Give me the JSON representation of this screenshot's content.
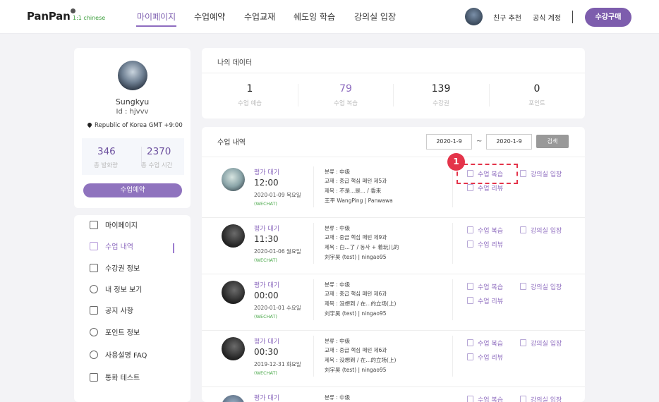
{
  "header": {
    "logo_text": "PanPan",
    "logo_sub": "1:1 chinese",
    "nav": [
      "마이페이지",
      "수업예약",
      "수업교재",
      "쉐도잉 학습",
      "강의실 입장"
    ],
    "links": [
      "친구 추천",
      "공식 계정"
    ],
    "buy_label": "수강구매"
  },
  "profile": {
    "name": "Sungkyu",
    "id_line": "Id : hjvvv",
    "location": "Republic of Korea GMT +9:00",
    "stats": [
      {
        "value": "346",
        "label": "총 발화량"
      },
      {
        "value": "2370",
        "label": "총 수업 시간"
      }
    ],
    "book_label": "수업예약"
  },
  "menu": [
    {
      "label": "마이페이지",
      "icon": "home-icon"
    },
    {
      "label": "수업 내역",
      "icon": "calendar-icon",
      "active": true
    },
    {
      "label": "수강권 정보",
      "icon": "ticket-icon"
    },
    {
      "label": "내 정보 보기",
      "icon": "user-icon"
    },
    {
      "label": "공지 사항",
      "icon": "notice-icon"
    },
    {
      "label": "포인트 정보",
      "icon": "percent-icon"
    },
    {
      "label": "사용설명 FAQ",
      "icon": "help-icon"
    },
    {
      "label": "통화 테스트",
      "icon": "document-icon"
    }
  ],
  "summary": {
    "title": "나의 데이터",
    "items": [
      {
        "value": "1",
        "label": "수업 예습"
      },
      {
        "value": "79",
        "label": "수업 복습"
      },
      {
        "value": "139",
        "label": "수강권"
      },
      {
        "value": "0",
        "label": "포인트"
      }
    ]
  },
  "history": {
    "title": "수업 내역",
    "date_from": "2020-1-9",
    "tilde": "~",
    "date_to": "2020-1-9",
    "search_label": "검색",
    "review_label": "수업 복습",
    "feedback_label": "수업 리뷰",
    "enter_label": "강의실 입장",
    "rows": [
      {
        "status": "평가 대기",
        "time": "12:00",
        "date": "2020-01-09 목요일",
        "platform": "(WECHAT)",
        "category": "분류 : 中级",
        "textbook": "교재 : 중급 핵심 패턴 제5과",
        "topic": "제목 : 不是...是... / 香来",
        "teacher": "王平 WangPing  |  Panwawa"
      },
      {
        "status": "평가 대기",
        "time": "11:30",
        "date": "2020-01-06 월요일",
        "platform": "(WECHAT)",
        "category": "분류 : 中级",
        "textbook": "교재 : 중급 핵심 패턴 제9과",
        "topic": "제목 : 白...了 / 동사 + 着玩儿的",
        "teacher": "刘宇昊 (test)  |  ningao95"
      },
      {
        "status": "평가 대기",
        "time": "00:00",
        "date": "2020-01-01 수요일",
        "platform": "(WECHAT)",
        "category": "분류 : 中级",
        "textbook": "교재 : 중급 핵심 패턴 제6과",
        "topic": "제목 : 没想到 / 在...的立场(上)",
        "teacher": "刘宇昊 (test)  |  ningao95"
      },
      {
        "status": "평가 대기",
        "time": "00:30",
        "date": "2019-12-31 화요일",
        "platform": "(WECHAT)",
        "category": "분류 : 中级",
        "textbook": "교재 : 중급 핵심 패턴 제6과",
        "topic": "제목 : 没想到 / 在...的立场(上)",
        "teacher": "刘宇昊 (test)  |  ningao95"
      },
      {
        "status": "평가 대기",
        "category": "분류 : 中级"
      }
    ]
  },
  "annotation": {
    "badge": "1"
  },
  "colors": {
    "accent": "#7d5dad",
    "highlight": "#e4344a",
    "platform": "#49a849"
  }
}
